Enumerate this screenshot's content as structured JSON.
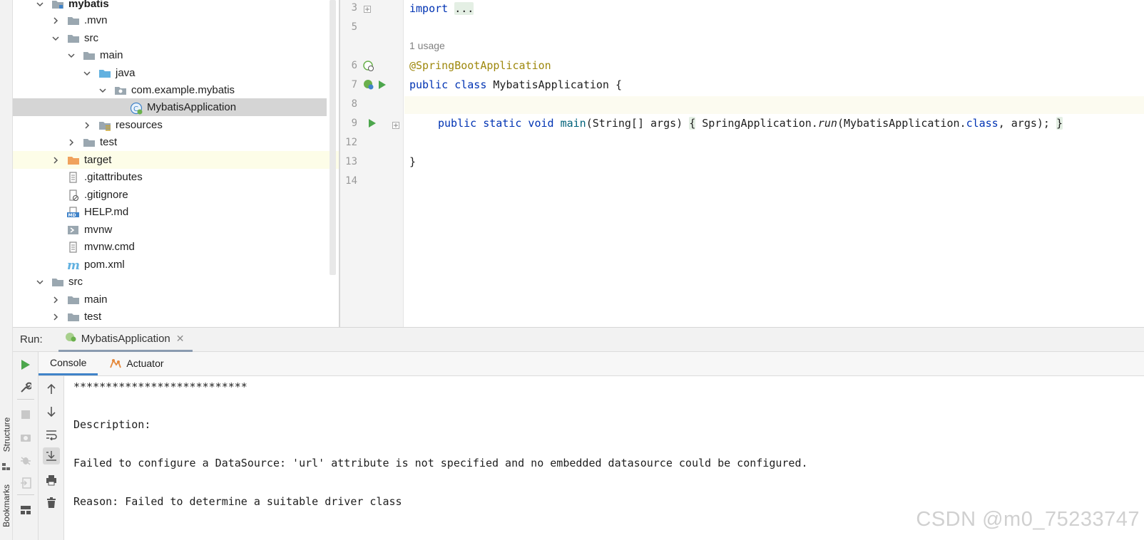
{
  "left_strip": {
    "structure_label": "Structure",
    "bookmarks_label": "Bookmarks"
  },
  "project_tree": {
    "items": [
      {
        "label": "mybatis",
        "type": "module"
      },
      {
        "label": ".mvn",
        "type": "folder"
      },
      {
        "label": "src",
        "type": "folder"
      },
      {
        "label": "main",
        "type": "folder"
      },
      {
        "label": "java",
        "type": "source-folder"
      },
      {
        "label": "com.example.mybatis",
        "type": "package"
      },
      {
        "label": "MybatisApplication",
        "type": "spring-class"
      },
      {
        "label": "resources",
        "type": "resources-folder"
      },
      {
        "label": "test",
        "type": "folder"
      },
      {
        "label": "target",
        "type": "excluded-folder"
      },
      {
        "label": ".gitattributes",
        "type": "file"
      },
      {
        "label": ".gitignore",
        "type": "gitignore-file"
      },
      {
        "label": "HELP.md",
        "type": "markdown-file"
      },
      {
        "label": "mvnw",
        "type": "script-file"
      },
      {
        "label": "mvnw.cmd",
        "type": "file"
      },
      {
        "label": "pom.xml",
        "type": "maven-file"
      },
      {
        "label": "src",
        "type": "folder"
      },
      {
        "label": "main",
        "type": "folder"
      },
      {
        "label": "test",
        "type": "folder"
      }
    ]
  },
  "editor": {
    "line_numbers": [
      "3",
      "5",
      "6",
      "7",
      "8",
      "9",
      "12",
      "13",
      "14"
    ],
    "usage_hint": "1 usage",
    "lines": {
      "import_kw": "import",
      "import_fold": "...",
      "annotation": "@SpringBootApplication",
      "class_kw": "public class",
      "class_name": " MybatisApplication {",
      "method_kw": "public static void",
      "method_name": " main",
      "method_sig": "(String[] args) ",
      "open_brace": "{",
      "body_pre": " SpringApplication.",
      "body_run": "run",
      "body_mid": "(MybatisApplication.",
      "body_class_kw": "class",
      "body_post": ", args); ",
      "close_brace": "}",
      "class_close": "}"
    }
  },
  "run_panel": {
    "label": "Run:",
    "tab_label": "MybatisApplication",
    "tab_close": "✕",
    "console_tab": "Console",
    "actuator_tab": "Actuator",
    "console_lines": [
      "***************************",
      "Description:",
      "Failed to configure a DataSource: 'url' attribute is not specified and no embedded datasource could be configured.",
      "Reason: Failed to determine a suitable driver class"
    ]
  },
  "watermark": "CSDN @m0_75233747",
  "colors": {
    "keyword": "#0033b3",
    "annotation": "#9e880d",
    "run_green": "#4ca64c",
    "selection": "#d5d5d5"
  }
}
